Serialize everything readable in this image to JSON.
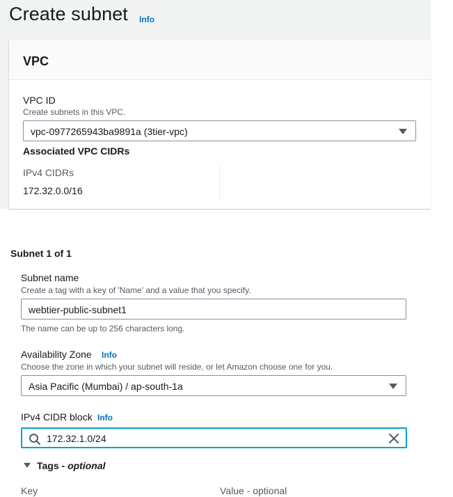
{
  "page": {
    "title": "Create subnet",
    "info_label": "Info"
  },
  "vpc_section": {
    "title": "VPC",
    "vpc_id_label": "VPC ID",
    "vpc_id_description": "Create subnets in this VPC.",
    "vpc_id_selected": "vpc-0977265943ba9891a (3tier-vpc)",
    "associated_title": "Associated VPC CIDRs",
    "ipv4_cidrs_label": "IPv4 CIDRs",
    "ipv4_cidrs_value": "172.32.0.0/16"
  },
  "subnet": {
    "heading": "Subnet 1 of 1",
    "name_label": "Subnet name",
    "name_description": "Create a tag with a key of 'Name' and a value that you specify.",
    "name_value": "webtier-public-subnet1",
    "name_hint": "The name can be up to 256 characters long.",
    "az_label": "Availability Zone",
    "az_info": "Info",
    "az_description": "Choose the zone in which your subnet will reside, or let Amazon choose one for you.",
    "az_selected": "Asia Pacific (Mumbai) / ap-south-1a",
    "cidr_label": "IPv4 CIDR block",
    "cidr_info": "Info",
    "cidr_value": "172.32.1.0/24",
    "tags_label": "Tags - ",
    "tags_optional": "optional",
    "key_column": "Key",
    "value_column": "Value - optional"
  },
  "colors": {
    "link": "#0073bb",
    "focus_border": "#00a1c9",
    "text": "#16191f",
    "secondary_text": "#545b64",
    "page_band": "#f2f3f3"
  },
  "icons": {
    "dropdown": "caret-down-icon",
    "search": "search-icon",
    "clear": "close-icon",
    "expand": "caret-down-icon"
  }
}
